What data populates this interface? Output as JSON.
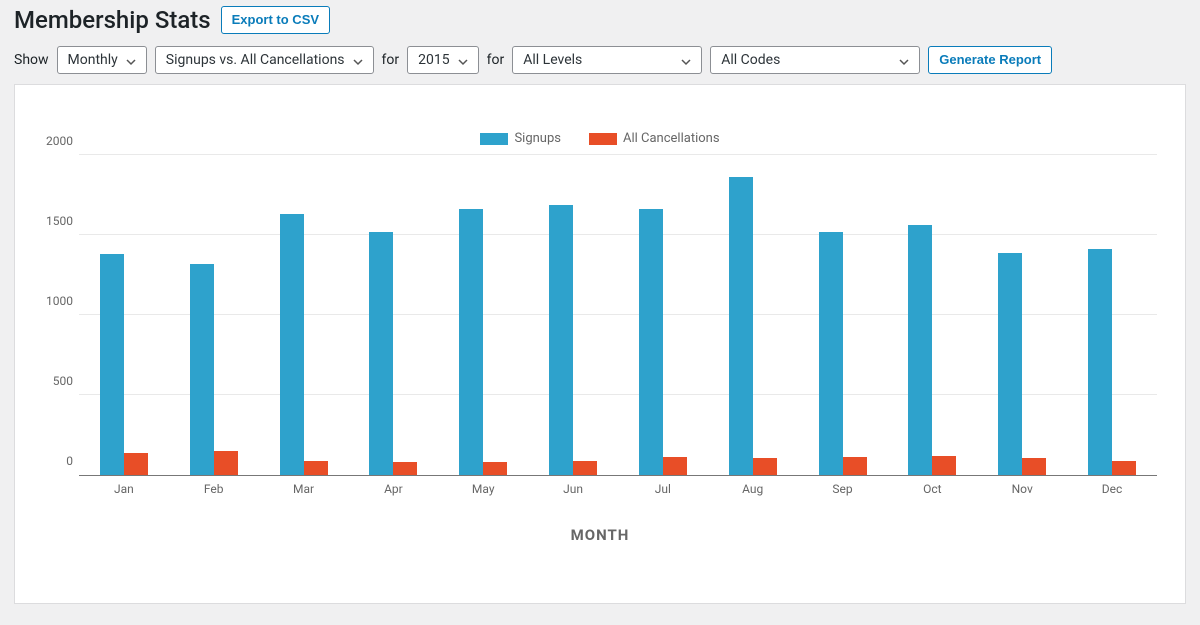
{
  "header": {
    "title": "Membership Stats",
    "export_label": "Export to CSV"
  },
  "filters": {
    "show_label": "Show",
    "period_value": "Monthly",
    "metric_value": "Signups vs. All Cancellations",
    "for_label_1": "for",
    "year_value": "2015",
    "for_label_2": "for",
    "levels_value": "All Levels",
    "codes_value": "All Codes",
    "generate_label": "Generate Report"
  },
  "legend": {
    "series_a": "Signups",
    "series_b": "All Cancellations"
  },
  "axis": {
    "x_title": "MONTH",
    "y_ticks": [
      "0",
      "500",
      "1000",
      "1500",
      "2000"
    ]
  },
  "colors": {
    "signups": "#2ea2cc",
    "cancellations": "#e84e27",
    "accent": "#0a7cba"
  },
  "chart_data": {
    "type": "bar",
    "title": "Membership Stats",
    "xlabel": "MONTH",
    "ylabel": "",
    "ylim": [
      0,
      2000
    ],
    "categories": [
      "Jan",
      "Feb",
      "Mar",
      "Apr",
      "May",
      "Jun",
      "Jul",
      "Aug",
      "Sep",
      "Oct",
      "Nov",
      "Dec"
    ],
    "series": [
      {
        "name": "Signups",
        "color": "#2ea2cc",
        "values": [
          1380,
          1320,
          1630,
          1520,
          1660,
          1690,
          1660,
          1860,
          1520,
          1560,
          1390,
          1410
        ]
      },
      {
        "name": "All Cancellations",
        "color": "#e84e27",
        "values": [
          135,
          150,
          90,
          80,
          80,
          90,
          115,
          105,
          115,
          120,
          105,
          90
        ]
      }
    ]
  }
}
